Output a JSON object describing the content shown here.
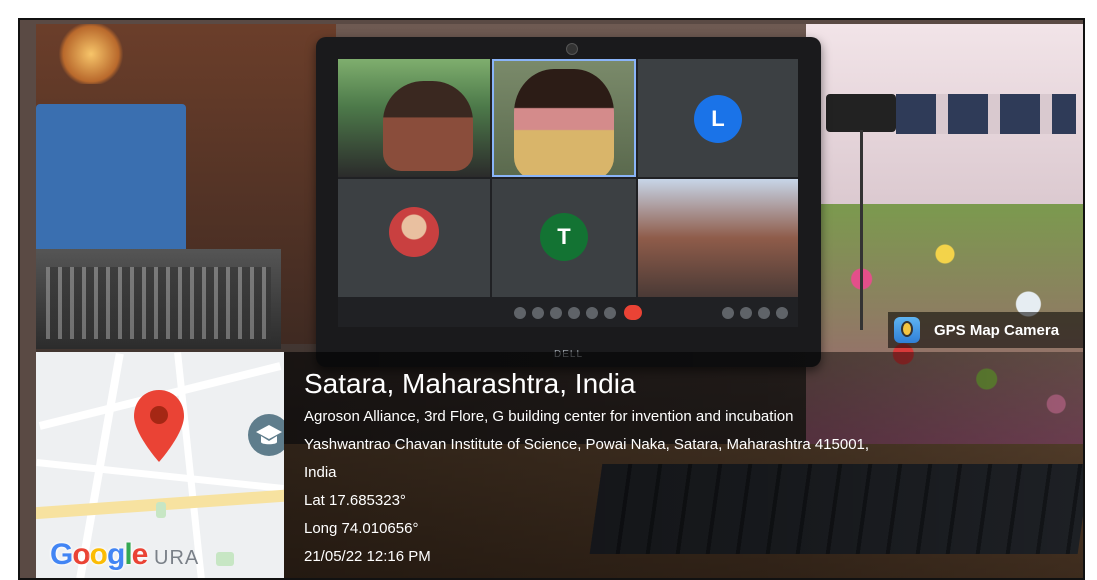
{
  "badge": {
    "label": "GPS Map Camera",
    "icon": "gps-map-camera-icon"
  },
  "location": {
    "title": "Satara, Maharashtra, India",
    "address_line1": "Agroson Alliance, 3rd Flore, G building center for invention and incubation",
    "address_line2": "Yashwantrao Chavan Institute of Science, Powai Naka, Satara, Maharashtra 415001,",
    "address_line3": "India",
    "lat": "Lat 17.685323°",
    "long": "Long 74.010656°",
    "datetime": "21/05/22 12:16 PM"
  },
  "map": {
    "logo": "Google",
    "suffix": "URA"
  },
  "meeting": {
    "tiles": [
      {
        "type": "camera"
      },
      {
        "type": "camera"
      },
      {
        "type": "initial",
        "initial": "L",
        "color": "#1a73e8"
      },
      {
        "type": "photo-avatar"
      },
      {
        "type": "initial",
        "initial": "T",
        "color": "#137333"
      },
      {
        "type": "camera"
      }
    ]
  },
  "monitor": {
    "brand": "DELL"
  }
}
